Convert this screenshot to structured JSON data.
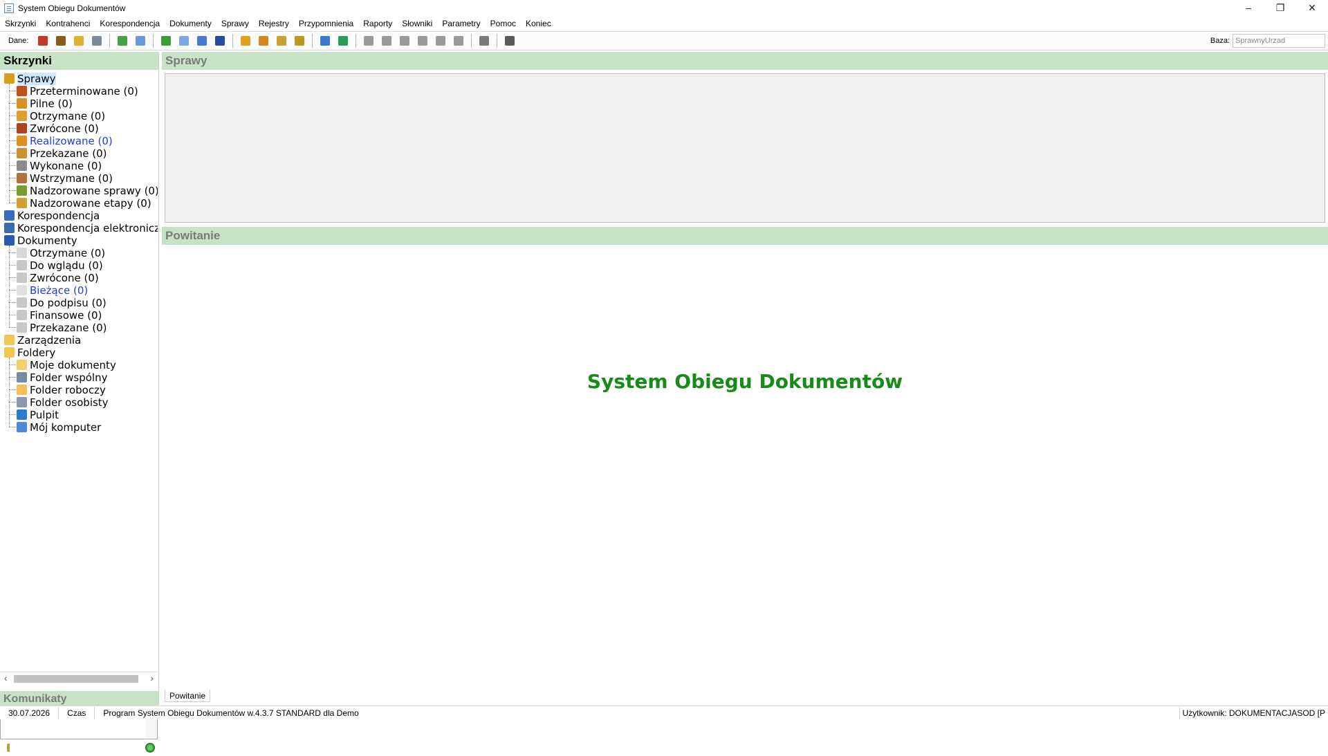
{
  "window": {
    "title": "System Obiegu Dokumentów",
    "controls": [
      "–",
      "❐",
      "✕"
    ]
  },
  "menu": [
    "Skrzynki",
    "Kontrahenci",
    "Korespondencja",
    "Dokumenty",
    "Sprawy",
    "Rejestry",
    "Przypomnienia",
    "Raporty",
    "Słowniki",
    "Parametry",
    "Pomoc",
    "Koniec"
  ],
  "toolbar": {
    "label": "Dane:",
    "baza_label": "Baza:",
    "baza_value": "SprawnyUrzad",
    "buttons": [
      {
        "icon": "contractors-icon",
        "color": "#c0392b"
      },
      {
        "icon": "users-icon",
        "color": "#8a5a1a"
      },
      {
        "icon": "folder-open-icon",
        "color": "#e0b030"
      },
      {
        "icon": "list-settings-icon",
        "color": "#7a8a9a"
      },
      {
        "icon": "import-icon",
        "color": "#4aa04a"
      },
      {
        "icon": "documents-icon",
        "color": "#6a9ad6"
      },
      {
        "icon": "incoming-letter-icon",
        "color": "#3b9a3b"
      },
      {
        "icon": "new-document-icon",
        "color": "#7ea8e0"
      },
      {
        "icon": "copy-document-icon",
        "color": "#4a7ad0"
      },
      {
        "icon": "register-icon",
        "color": "#2a4aa0"
      },
      {
        "icon": "case-add-icon",
        "color": "#e0a020"
      },
      {
        "icon": "case-folder-icon",
        "color": "#d08820"
      },
      {
        "icon": "case-forward-icon",
        "color": "#c8a030"
      },
      {
        "icon": "case-chart-icon",
        "color": "#b89a20"
      },
      {
        "icon": "reminder-clock-icon",
        "color": "#3a7ad0"
      },
      {
        "icon": "refresh-globe-icon",
        "color": "#2a9a5a"
      },
      {
        "icon": "print-icon",
        "color": "#9a9a9a"
      },
      {
        "icon": "mail-icon",
        "color": "#9a9a9a"
      },
      {
        "icon": "mail-send-icon",
        "color": "#9a9a9a"
      },
      {
        "icon": "sort-asc-icon",
        "color": "#9a9a9a"
      },
      {
        "icon": "sort-desc-icon",
        "color": "#9a9a9a"
      },
      {
        "icon": "list-edit-icon",
        "color": "#9a9a9a"
      },
      {
        "icon": "check-icon",
        "color": "#7a7a7a"
      },
      {
        "icon": "binoculars-icon",
        "color": "#5a5a5a"
      }
    ]
  },
  "skrzynki": {
    "title": "Skrzynki",
    "tree": [
      {
        "label": "Sprawy",
        "level": 0,
        "icon": "cases-icon",
        "color": "#d4a020",
        "selected": true
      },
      {
        "label": "Przeterminowane (0)",
        "level": 1,
        "icon": "case-overdue-icon",
        "color": "#c05020"
      },
      {
        "label": "Pilne (0)",
        "level": 1,
        "icon": "case-urgent-icon",
        "color": "#d89020"
      },
      {
        "label": "Otrzymane (0)",
        "level": 1,
        "icon": "case-received-icon",
        "color": "#e0a030"
      },
      {
        "label": "Zwrócone (0)",
        "level": 1,
        "icon": "case-returned-icon",
        "color": "#b04020"
      },
      {
        "label": "Realizowane (0)",
        "level": 1,
        "icon": "case-in-progress-icon",
        "color": "#e09020",
        "blue": true
      },
      {
        "label": "Przekazane (0)",
        "level": 1,
        "icon": "case-forwarded-icon",
        "color": "#c89030"
      },
      {
        "label": "Wykonane (0)",
        "level": 1,
        "icon": "case-done-icon",
        "color": "#8a8a8a"
      },
      {
        "label": "Wstrzymane (0)",
        "level": 1,
        "icon": "case-suspended-icon",
        "color": "#b07040"
      },
      {
        "label": "Nadzorowane sprawy (0)",
        "level": 1,
        "icon": "supervised-cases-icon",
        "color": "#7a9a30"
      },
      {
        "label": "Nadzorowane etapy (0)",
        "level": 1,
        "icon": "supervised-stages-icon",
        "color": "#d0a030"
      },
      {
        "label": "Korespondencja",
        "level": 0,
        "icon": "correspondence-icon",
        "color": "#3a6ac0"
      },
      {
        "label": "Korespondencja elektroniczr",
        "level": 0,
        "icon": "e-correspondence-icon",
        "color": "#3a6ab0"
      },
      {
        "label": "Dokumenty",
        "level": 0,
        "icon": "documents-icon",
        "color": "#2a5ab0"
      },
      {
        "label": "Otrzymane (0)",
        "level": 1,
        "icon": "doc-received-icon",
        "color": "#d8d8d8"
      },
      {
        "label": "Do wglądu (0)",
        "level": 1,
        "icon": "doc-review-icon",
        "color": "#c8c8c8"
      },
      {
        "label": "Zwrócone (0)",
        "level": 1,
        "icon": "doc-returned-icon",
        "color": "#c8c8c8"
      },
      {
        "label": "Bieżące (0)",
        "level": 1,
        "icon": "doc-current-icon",
        "color": "#e0e0e0",
        "blue": true
      },
      {
        "label": "Do podpisu (0)",
        "level": 1,
        "icon": "doc-sign-icon",
        "color": "#c8c8c8"
      },
      {
        "label": "Finansowe (0)",
        "level": 1,
        "icon": "doc-finance-icon",
        "color": "#c8c8c8"
      },
      {
        "label": "Przekazane (0)",
        "level": 1,
        "icon": "doc-forwarded-icon",
        "color": "#c8c8c8"
      },
      {
        "label": "Zarządzenia",
        "level": 0,
        "icon": "folder-icon",
        "color": "#f0c850"
      },
      {
        "label": "Foldery",
        "level": 0,
        "icon": "folder-open-icon",
        "color": "#f0c850"
      },
      {
        "label": "Moje dokumenty",
        "level": 1,
        "icon": "my-documents-icon",
        "color": "#f0d070"
      },
      {
        "label": "Folder wspólny",
        "level": 1,
        "icon": "shared-folder-icon",
        "color": "#7a8aa0"
      },
      {
        "label": "Folder roboczy",
        "level": 1,
        "icon": "work-folder-icon",
        "color": "#f0c060"
      },
      {
        "label": "Folder osobisty",
        "level": 1,
        "icon": "personal-folder-icon",
        "color": "#8a9aaa"
      },
      {
        "label": "Pulpit",
        "level": 1,
        "icon": "desktop-icon",
        "color": "#2a7ad0"
      },
      {
        "label": "Mój komputer",
        "level": 1,
        "icon": "computer-icon",
        "color": "#4a8ad8"
      }
    ]
  },
  "komunikaty": {
    "title": "Komunikaty"
  },
  "sprawy_panel": {
    "title": "Sprawy"
  },
  "powitanie_panel": {
    "title": "Powitanie",
    "welcome_text": "System Obiegu Dokumentów",
    "tab": "Powitanie"
  },
  "status": {
    "date": "30.07.2026",
    "time_label": "Czas",
    "program": "Program System Obiegu Dokumentów w.4.3.7 STANDARD dla Demo",
    "user": "Użytkownik: DOKUMENTACJASOD [P"
  }
}
